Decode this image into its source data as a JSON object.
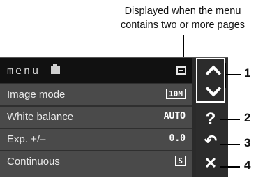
{
  "callout_caption": {
    "line1": "Displayed when the menu",
    "line2": "contains two or more pages"
  },
  "callout_numbers": [
    "1",
    "2",
    "3",
    "4"
  ],
  "menu": {
    "title": "menu",
    "tab_icon": "camera-icon",
    "page_indicator_icon": "page-icon",
    "items": [
      {
        "label": "Image mode",
        "value": "10M"
      },
      {
        "label": "White balance",
        "value": "AUTO"
      },
      {
        "label": "Exp. +/–",
        "value": "0.0"
      },
      {
        "label": "Continuous",
        "value": "S"
      }
    ]
  },
  "side_controls": {
    "scroll_up_icon": "chevron-up-icon",
    "scroll_down_icon": "chevron-down-icon",
    "help_label": "?",
    "back_label": "↶",
    "close_label": "✕"
  }
}
